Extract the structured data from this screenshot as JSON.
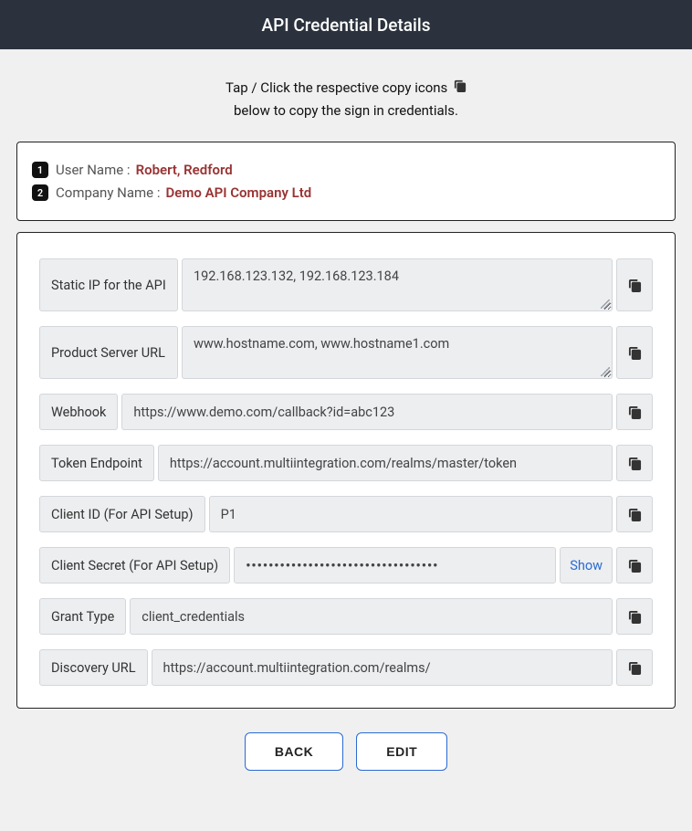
{
  "header": {
    "title": "API Credential Details"
  },
  "instructions": {
    "line1": "Tap / Click the respective copy icons",
    "line2": "below to copy the sign in credentials."
  },
  "user_panel": {
    "badge1": "1",
    "badge2": "2",
    "user_label": "User Name :",
    "user_value": "Robert, Redford",
    "company_label": "Company Name :",
    "company_value": "Demo API Company Ltd"
  },
  "fields": {
    "static_ip": {
      "label": "Static IP for the API",
      "value": "192.168.123.132, 192.168.123.184"
    },
    "product_server": {
      "label": "Product Server URL",
      "value": "www.hostname.com, www.hostname1.com"
    },
    "webhook": {
      "label": "Webhook",
      "value": "https://www.demo.com/callback?id=abc123"
    },
    "token_endpoint": {
      "label": "Token Endpoint",
      "value": "https://account.multiintegration.com/realms/master/token"
    },
    "client_id": {
      "label": "Client ID (For API Setup)",
      "value": "P1"
    },
    "client_secret": {
      "label": "Client Secret (For API Setup)",
      "value_masked": "••••••••••••••••••••••••••••••••••",
      "show_label": "Show"
    },
    "grant_type": {
      "label": "Grant Type",
      "value": "client_credentials"
    },
    "discovery_url": {
      "label": "Discovery URL",
      "value": "https://account.multiintegration.com/realms/"
    }
  },
  "buttons": {
    "back": "BACK",
    "edit": "EDIT"
  }
}
